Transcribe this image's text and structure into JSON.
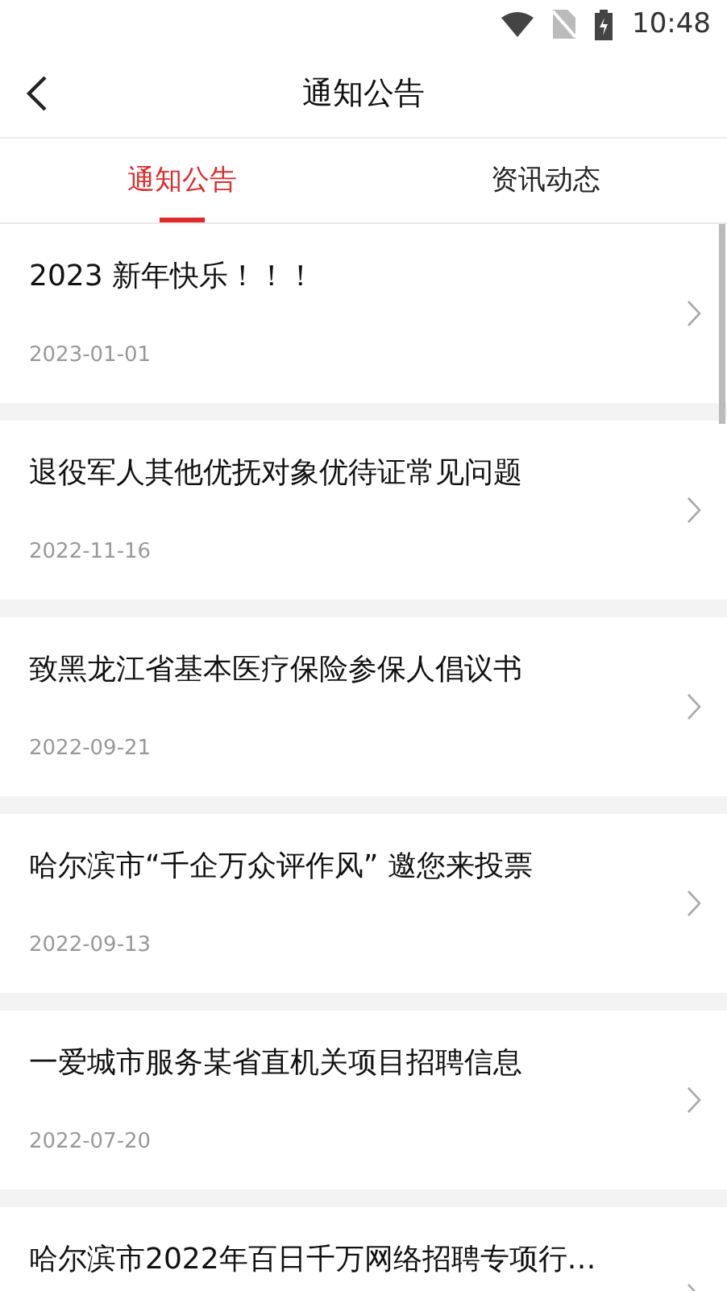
{
  "status_bar": {
    "time": "10:48"
  },
  "header": {
    "title": "通知公告"
  },
  "tabs": [
    {
      "label": "通知公告",
      "selected": true
    },
    {
      "label": "资讯动态",
      "selected": false
    }
  ],
  "items": [
    {
      "title": "2023 新年快乐！！！",
      "date": "2023-01-01"
    },
    {
      "title": "退役军人其他优抚对象优待证常见问题",
      "date": "2022-11-16"
    },
    {
      "title": "致黑龙江省基本医疗保险参保人倡议书",
      "date": "2022-09-21"
    },
    {
      "title": "哈尔滨市“千企万众评作风” 邀您来投票",
      "date": "2022-09-13"
    },
    {
      "title": "一爱城市服务某省直机关项目招聘信息",
      "date": "2022-07-20"
    },
    {
      "title": "哈尔滨市2022年百日千万网络招聘专项行…"
    }
  ]
}
